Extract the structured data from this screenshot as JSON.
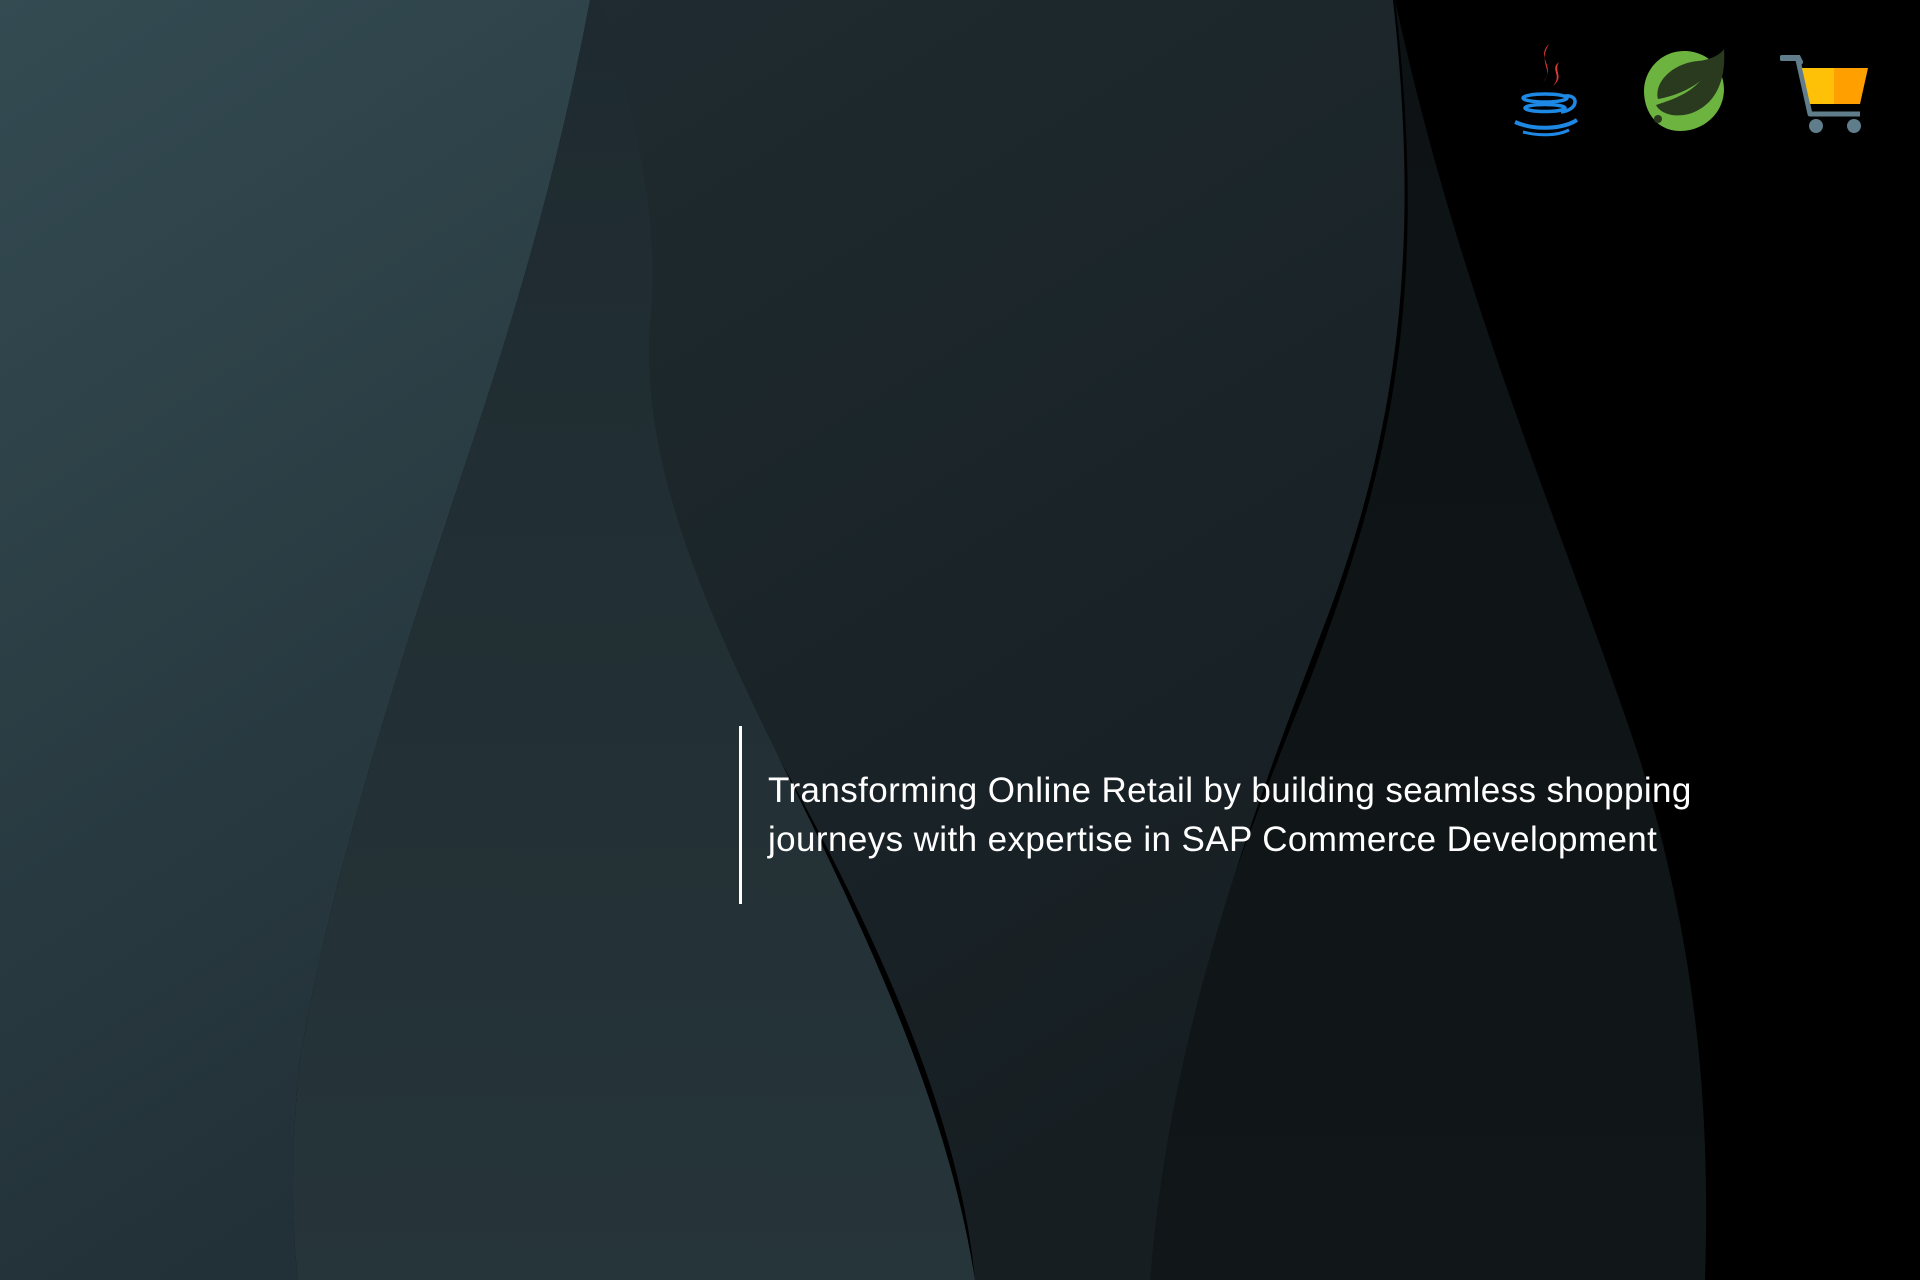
{
  "tagline": {
    "line1": "Transforming Online Retail by building seamless shopping",
    "line2": "journeys with expertise in SAP Commerce Development"
  },
  "icons": [
    {
      "name": "java-icon"
    },
    {
      "name": "spring-leaf-icon"
    },
    {
      "name": "shopping-cart-icon"
    }
  ],
  "colors": {
    "background": "#000000",
    "panel_left": "#2e4148",
    "panel_mid": "#1c262b",
    "text": "#ffffff",
    "java_red": "#e53935",
    "java_blue": "#1e88e5",
    "spring_green": "#6db33f",
    "cart_orange": "#ffa000",
    "cart_yellow": "#ffc107",
    "cart_gray": "#607d8b"
  }
}
